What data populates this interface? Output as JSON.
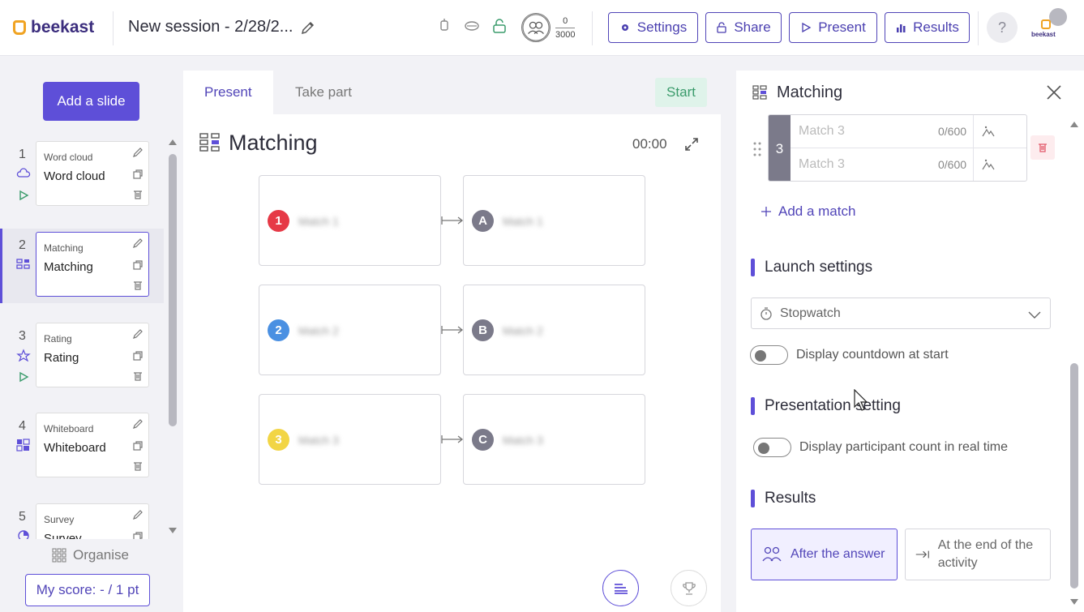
{
  "header": {
    "logo_text": "beekast",
    "session_title": "New session - 2/28/2...",
    "participants_count": "0",
    "participants_max": "3000",
    "buttons": {
      "settings": "Settings",
      "share": "Share",
      "present": "Present",
      "results": "Results"
    },
    "help": "?",
    "brand_small": "beekast"
  },
  "sidebar": {
    "add_slide": "Add a slide",
    "slides": [
      {
        "num": "1",
        "type": "Word cloud",
        "name": "Word cloud"
      },
      {
        "num": "2",
        "type": "Matching",
        "name": "Matching"
      },
      {
        "num": "3",
        "type": "Rating",
        "name": "Rating"
      },
      {
        "num": "4",
        "type": "Whiteboard",
        "name": "Whiteboard"
      },
      {
        "num": "5",
        "type": "Survey",
        "name": "Survey"
      }
    ],
    "organise": "Organise",
    "score": "My score: - / 1 pt"
  },
  "center": {
    "tabs": {
      "present": "Present",
      "take_part": "Take part"
    },
    "start": "Start",
    "activity_title": "Matching",
    "timer": "00:00",
    "left_items": [
      {
        "label": "1",
        "text": "Match 1",
        "color": "#e63946"
      },
      {
        "label": "2",
        "text": "Match 2",
        "color": "#4a90e2"
      },
      {
        "label": "3",
        "text": "Match 3",
        "color": "#f2d545"
      }
    ],
    "right_items": [
      {
        "label": "A",
        "text": "Match 1"
      },
      {
        "label": "B",
        "text": "Match 2"
      },
      {
        "label": "C",
        "text": "Match 3"
      }
    ]
  },
  "right_panel": {
    "title": "Matching",
    "match_item": {
      "num": "3",
      "placeholder_1": "Match 3",
      "count_1": "0/600",
      "placeholder_2": "Match 3",
      "count_2": "0/600"
    },
    "add_match": "Add a match",
    "launch_settings": "Launch settings",
    "stopwatch": "Stopwatch",
    "display_countdown": "Display countdown at start",
    "presentation_setting": "Presentation setting",
    "display_participant_count": "Display participant count in real time",
    "results": "Results",
    "after_answer": "After the answer",
    "end_activity": "At the end of the activity"
  },
  "colors": {
    "accent": "#5e4fd8",
    "start_bg": "#dff3ea",
    "start_text": "#3a9b6b"
  }
}
